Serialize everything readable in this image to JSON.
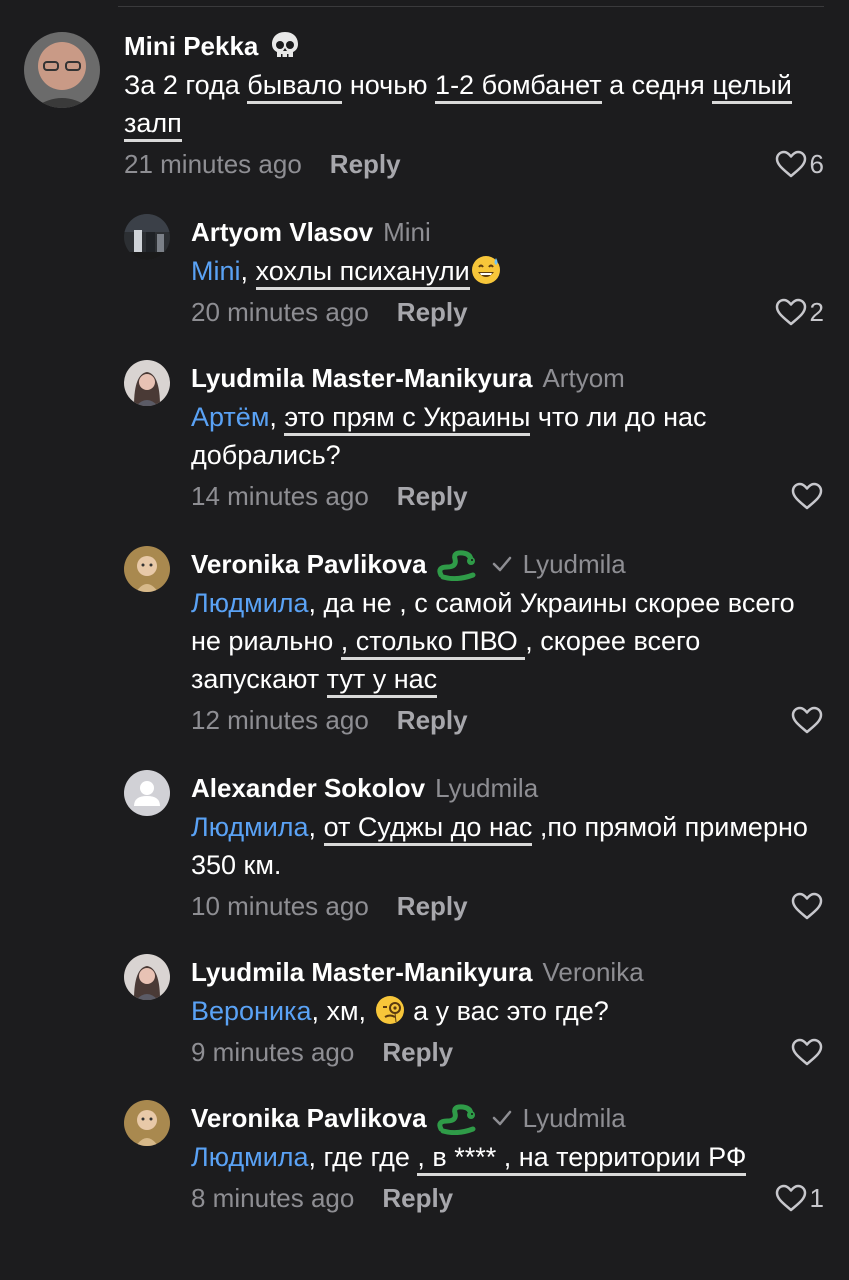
{
  "comments": [
    {
      "author": "Mini Pekka",
      "reply_to": "",
      "text_parts": [
        "За 2 года ",
        "бывало",
        " ночью ",
        "1-2 бомбанет",
        " а седня ",
        "целый залп"
      ],
      "time": "21 minutes ago",
      "reply_label": "Reply",
      "likes": "6"
    },
    {
      "author": "Artyom Vlasov",
      "reply_to": "Mini",
      "mention": "Mini",
      "text_parts": [
        ", ",
        "хохлы психанули"
      ],
      "time": "20 minutes ago",
      "reply_label": "Reply",
      "likes": "2"
    },
    {
      "author": "Lyudmila Master-Manikyura",
      "reply_to": "Artyom",
      "mention": "Артём",
      "text_parts": [
        ", ",
        "это прям с Украины",
        " что ли до нас добрались?"
      ],
      "time": "14 minutes ago",
      "reply_label": "Reply",
      "likes": ""
    },
    {
      "author": "Veronika Pavlikova",
      "reply_to": "Lyudmila",
      "mention": "Людмила",
      "text_parts": [
        ", да не , с самой Украины скорее всего не риально ",
        ", столько ПВО ",
        ", скорее всего запускают ",
        "тут у нас"
      ],
      "time": "12 minutes ago",
      "reply_label": "Reply",
      "likes": ""
    },
    {
      "author": "Alexander Sokolov",
      "reply_to": "Lyudmila",
      "mention": "Людмила",
      "text_parts": [
        ", ",
        "от Суджы до нас",
        " ,по прямой примерно 350 км."
      ],
      "time": "10 minutes ago",
      "reply_label": "Reply",
      "likes": ""
    },
    {
      "author": "Lyudmila Master-Manikyura",
      "reply_to": "Veronika",
      "mention": "Вероника",
      "text_parts": [
        ", хм, ",
        " а у вас это где?"
      ],
      "time": "9 minutes ago",
      "reply_label": "Reply",
      "likes": ""
    },
    {
      "author": "Veronika Pavlikova",
      "reply_to": "Lyudmila",
      "mention": "Людмила",
      "text_parts": [
        ", где где ",
        ", в **** , на территории РФ"
      ],
      "time": "8 minutes ago",
      "reply_label": "Reply",
      "likes": "1"
    }
  ],
  "icons": {
    "like": "heart-outline-icon",
    "verified": "checkmark-icon",
    "badge_1": "skull-emoji",
    "badge_2": "snake-emoji",
    "emoji_sweat": "grinning-sweat-emoji",
    "emoji_monocle": "monocle-face-emoji"
  },
  "colors": {
    "background": "#1c1c1e",
    "mention": "#5aa2f5",
    "secondary_text": "#8e8e93",
    "underline": "#d9d9d9"
  }
}
